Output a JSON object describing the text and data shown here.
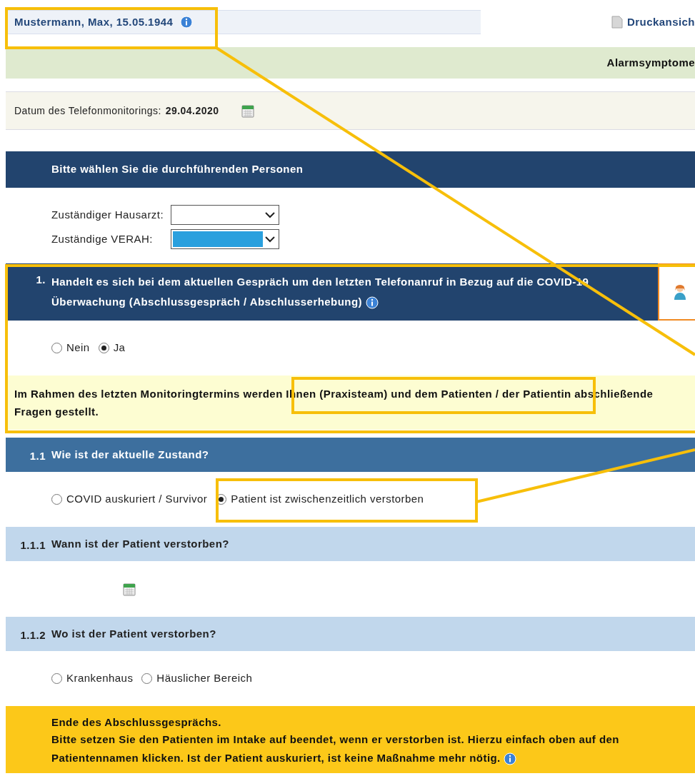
{
  "patient": {
    "name": "Mustermann, Max, 15.05.1944"
  },
  "print_link": "Druckansich",
  "alarm_bar": "Alarmsymptome",
  "monitoring_date": {
    "label": "Datum des Telefonmonitorings:",
    "value": "29.04.2020"
  },
  "persons": {
    "title": "Bitte wählen Sie die durchführenden Personen",
    "fields": [
      {
        "label": "Zuständiger Hausarzt:",
        "selected": false
      },
      {
        "label": "Zuständige VERAH:",
        "selected": true
      }
    ]
  },
  "sections": [
    {
      "kind": "main",
      "number": "1.",
      "title": "Handelt es sich bei dem aktuellen Gespräch um den letzten Telefonanruf in Bezug auf die COVID-19 Überwachung (Abschlussgespräch / Abschlusserhebung)",
      "info": true,
      "options": [
        {
          "label": "Nein",
          "selected": false
        },
        {
          "label": "Ja",
          "selected": true
        }
      ],
      "note": "Im Rahmen des letzten Monitoringtermins werden Ihnen (Praxisteam) und dem Patienten / der Patientin abschließende Fragen gestellt."
    },
    {
      "kind": "sub",
      "number": "1.1",
      "title": "Wie ist der aktuelle Zustand?",
      "options": [
        {
          "label": "COVID auskuriert / Survivor",
          "selected": false
        },
        {
          "label": "Patient ist zwischenzeitlich verstorben",
          "selected": true
        }
      ]
    },
    {
      "kind": "subsub",
      "number": "1.1.1",
      "title": "Wann ist der Patient verstorben?",
      "date_picker": true
    },
    {
      "kind": "subsub",
      "number": "1.1.2",
      "title": "Wo ist der Patient verstorben?",
      "options": [
        {
          "label": "Krankenhaus",
          "selected": false
        },
        {
          "label": "Häuslicher Bereich",
          "selected": false
        }
      ]
    }
  ],
  "end_note": {
    "title": "Ende des Abschlussgesprächs.",
    "text": "Bitte setzen Sie den Patienten im Intake auf beendet, wenn er verstorben ist. Hierzu einfach oben auf den Patientennamen klicken. Ist der Patient auskuriert, ist keine Maßnahme mehr nötig.",
    "info": true
  }
}
